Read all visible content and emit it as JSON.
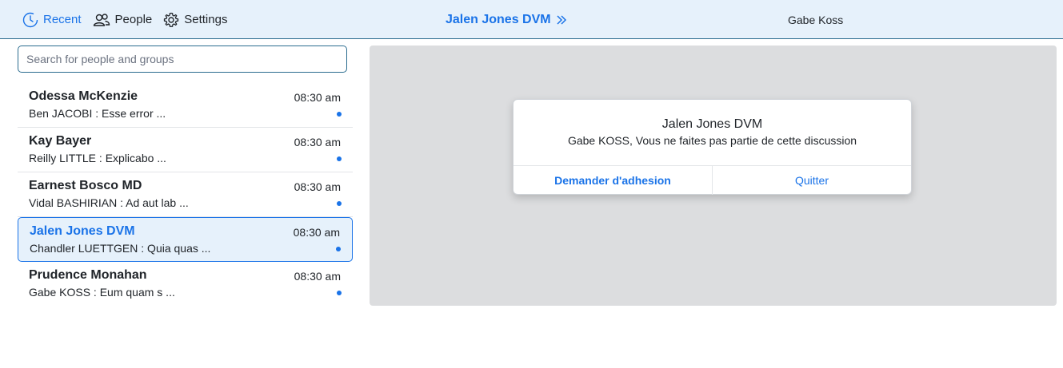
{
  "nav": {
    "recent_label": "Recent",
    "people_label": "People",
    "settings_label": "Settings"
  },
  "header": {
    "conversation_title": "Jalen Jones DVM",
    "current_user": "Gabe Koss"
  },
  "search": {
    "placeholder": "Search for people and groups",
    "value": ""
  },
  "conversations": [
    {
      "name": "Odessa McKenzie",
      "time": "08:30 am",
      "preview": "Ben JACOBI : Esse error ...",
      "unread": true
    },
    {
      "name": "Kay Bayer",
      "time": "08:30 am",
      "preview": "Reilly LITTLE : Explicabo ...",
      "unread": true
    },
    {
      "name": "Earnest Bosco MD",
      "time": "08:30 am",
      "preview": "Vidal BASHIRIAN : Ad aut lab ...",
      "unread": true
    },
    {
      "name": "Jalen Jones DVM",
      "time": "08:30 am",
      "preview": "Chandler LUETTGEN : Quia quas ...",
      "unread": true,
      "selected": true
    },
    {
      "name": "Prudence Monahan",
      "time": "08:30 am",
      "preview": "Gabe KOSS : Eum quam s ...",
      "unread": true
    }
  ],
  "dialog": {
    "title": "Jalen Jones DVM",
    "message": "Gabe KOSS, Vous ne faites pas partie de cette discussion",
    "join_label": "Demander d'adhesion",
    "quit_label": "Quitter"
  },
  "colors": {
    "accent": "#1a73e8",
    "header_bg": "#e6f1fb",
    "panel_bg": "#dcdddf"
  },
  "icons": {
    "recent": "clock-icon",
    "people": "people-icon",
    "settings": "gear-icon",
    "title": "double-chevron-right-icon"
  }
}
